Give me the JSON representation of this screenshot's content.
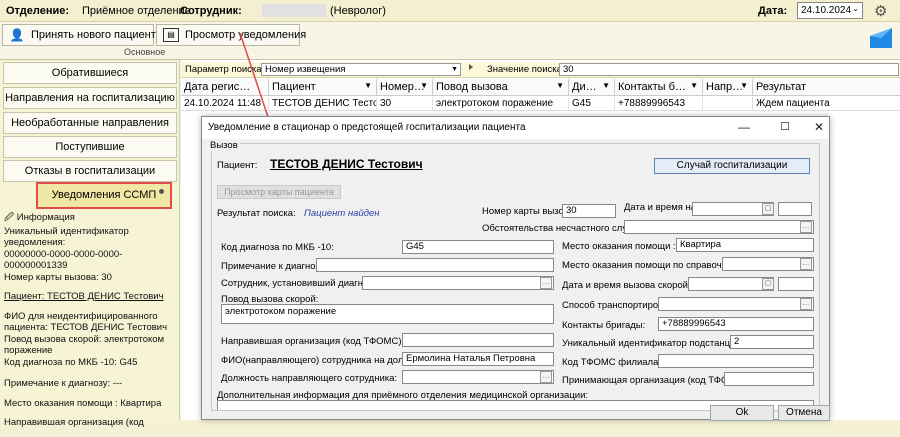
{
  "top": {
    "dept_label": "Отделение:",
    "dept_value": "Приёмное отделение",
    "emp_label": "Сотрудник:",
    "emp_value": "(Невролог)",
    "date_label": "Дата:",
    "date_value": "24.10.2024"
  },
  "ribbon": {
    "new_patient": "Принять нового пациента",
    "view_notice": "Просмотр уведомления",
    "group_label": "Основное"
  },
  "nav": [
    "Обратившиеся",
    "Направления на госпитализацию",
    "Необработанные направления",
    "Поступившие",
    "Отказы в госпитализации",
    "Уведомления ССМП"
  ],
  "info": {
    "title": "Информация",
    "uid_label": "Уникальный идентификатор уведомления:",
    "uid_value": "00000000-0000-0000-0000-000000001339",
    "card": "Номер карты вызова: 30",
    "patient": "Пациент: ТЕСТОВ ДЕНИС Тестович",
    "fio_block": "ФИО для неидентифицированного пациента: ТЕСТОВ ДЕНИС Тестович",
    "reason": "Повод вызова скорой: электротоком поражение",
    "mkb": "Код диагноза по МКБ -10: G45",
    "note": "Примечание к диагнозу: ---",
    "place": "Место оказания помощи : Квартира",
    "org": "Направившая организация (код"
  },
  "search": {
    "param_label": "Параметр поиска",
    "param_value": "Номер извещения",
    "value_label": "Значение поиска",
    "value": "30"
  },
  "table": {
    "headers": [
      "Дата регис…",
      "Пациент",
      "Номер…",
      "Повод вызова",
      "Ди…",
      "Контакты б…",
      "Напр…",
      "Результат"
    ],
    "row": [
      "24.10.2024 11:48",
      "ТЕСТОВ ДЕНИС Тестов…",
      "30",
      "электротоком поражение",
      "G45",
      "+78889996543",
      "",
      "Ждем пациента"
    ]
  },
  "dialog": {
    "title": "Уведомление в стационар о предстоящей госпитализации пациента",
    "group": "Вызов",
    "patient_label": "Пациент:",
    "patient_value": "ТЕСТОВ ДЕНИС Тестович",
    "case_btn": "Случай госпитализации",
    "view_card_btn": "Просмотр карты пациента",
    "search_result_label": "Результат поиска:",
    "search_result_value": "Пациент найден",
    "card_no_label": "Номер карты вызова:",
    "card_no_value": "30",
    "accident_dt_label": "Дата и время н/с:",
    "circumstances_label": "Обстоятельства несчастного случая:",
    "mkb_label": "Код диагноза по МКБ -10:",
    "mkb_value": "G45",
    "place_label": "Место оказания помощи :",
    "place_value": "Квартира",
    "note_label": "Примечание к диагнозу:",
    "place_ref_label": "Место оказания помощи по справочнику:",
    "emp_diag_label": "Сотрудник, установивший диагноз:",
    "call_dt_label": "Дата и время вызова скорой:",
    "reason_label": "Повод вызова скорой:",
    "reason_value": "электротоком поражение",
    "transport_label": "Способ транспортировки:",
    "contacts_label": "Контакты бригады:",
    "contacts_value": "+78889996543",
    "org_label": "Направившая организация (код ТФОМС):",
    "substation_label": "Уникальный идентификатор подстанции:",
    "substation_value": "2",
    "fio_label": "ФИО(направляющего) сотрудника на должности:",
    "fio_value": "Ермолина Наталья Петровна",
    "tfoms_branch_label": "Код ТФОМС филиала:",
    "position_label": "Должность направляющего сотрудника:",
    "receiving_label": "Принимающая организация (код ТФОМС):",
    "extra_label": "Дополнительная информация для приёмного отделения медицинской организации:",
    "ok": "Ok",
    "cancel": "Отмена"
  },
  "colors": {
    "highlight": "#e34a4a",
    "link_blue": "#2a3fa8",
    "bg": "#f4f1d4"
  }
}
